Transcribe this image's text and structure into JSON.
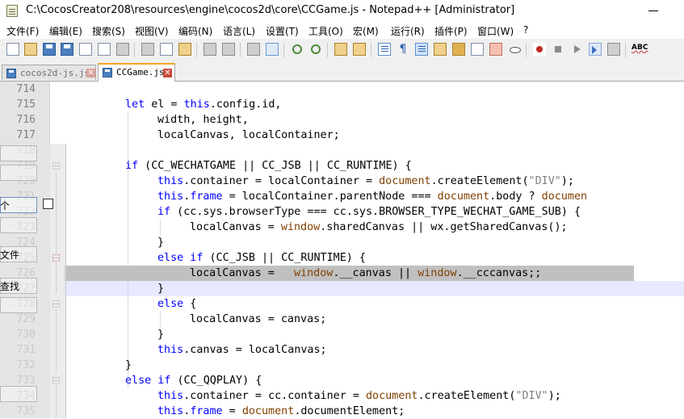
{
  "window": {
    "title": "C:\\CocosCreator208\\resources\\engine\\cocos2d\\core\\CCGame.js - Notepad++ [Administrator]",
    "minimize_glyph": "—"
  },
  "menu": [
    "文件(F)",
    "编辑(E)",
    "搜索(S)",
    "视图(V)",
    "编码(N)",
    "语言(L)",
    "设置(T)",
    "工具(O)",
    "宏(M)",
    "运行(R)",
    "插件(P)",
    "窗口(W)",
    "?"
  ],
  "toolbar": {
    "icons": [
      "new-file-icon",
      "open-file-icon",
      "save-icon",
      "save-all-icon",
      "close-icon",
      "close-all-icon",
      "print-icon",
      "cut-icon",
      "copy-icon",
      "paste-icon",
      "undo-icon",
      "redo-icon",
      "find-icon",
      "replace-icon",
      "zoom-in-icon",
      "zoom-out-icon",
      "sync-vertical-icon",
      "sync-horizontal-icon",
      "word-wrap-icon",
      "show-all-characters-icon",
      "indent-guide-icon",
      "user-language-icon",
      "document-map-icon",
      "function-list-icon",
      "folder-workspace-icon",
      "monitoring-icon",
      "record-macro-icon",
      "stop-recording-icon",
      "playback-icon",
      "run-macro-multiple-icon",
      "save-macro-icon",
      "spell-check-icon"
    ],
    "pilcrow": "¶",
    "spell_label": "ABC"
  },
  "tabs": [
    {
      "label": "cocos2d-js.js",
      "close": "✕",
      "active": false
    },
    {
      "label": "CCGame.js",
      "close": "✕",
      "active": true
    }
  ],
  "editor": {
    "line_numbers": [
      "714",
      "715",
      "716",
      "717",
      "718",
      "719",
      "720",
      "721",
      "722",
      "723",
      "724",
      "725",
      "726",
      "727",
      "728",
      "729",
      "730",
      "731",
      "732",
      "733",
      "734",
      "735"
    ],
    "lines": [
      {
        "indent": 0,
        "tokens": []
      },
      {
        "indent": 2,
        "tokens": [
          [
            "kw",
            "let"
          ],
          [
            "p",
            " el = "
          ],
          [
            "kw",
            "this"
          ],
          [
            "p",
            ".config.id,"
          ]
        ]
      },
      {
        "indent": 3,
        "tokens": [
          [
            "p",
            "width, height,"
          ]
        ]
      },
      {
        "indent": 3,
        "tokens": [
          [
            "p",
            "localCanvas, localContainer;"
          ]
        ]
      },
      {
        "indent": 0,
        "tokens": []
      },
      {
        "indent": 2,
        "tokens": [
          [
            "kw",
            "if"
          ],
          [
            "p",
            " (CC_WECHATGAME || CC_JSB || CC_RUNTIME) {"
          ]
        ]
      },
      {
        "indent": 3,
        "tokens": [
          [
            "kw",
            "this"
          ],
          [
            "p",
            ".container = localContainer = "
          ],
          [
            "obj",
            "document"
          ],
          [
            "p",
            ".createElement("
          ],
          [
            "str",
            "\"DIV\""
          ],
          [
            "p",
            ");"
          ]
        ]
      },
      {
        "indent": 3,
        "tokens": [
          [
            "kw",
            "this"
          ],
          [
            "p",
            "."
          ],
          [
            "kw",
            "frame"
          ],
          [
            "p",
            " = localContainer.parentNode === "
          ],
          [
            "obj",
            "document"
          ],
          [
            "p",
            ".body ? "
          ],
          [
            "obj",
            "documen"
          ]
        ]
      },
      {
        "indent": 3,
        "tokens": [
          [
            "kw",
            "if"
          ],
          [
            "p",
            " (cc.sys.browserType === cc.sys.BROWSER_TYPE_WECHAT_GAME_SUB) {"
          ]
        ]
      },
      {
        "indent": 4,
        "tokens": [
          [
            "p",
            "localCanvas = "
          ],
          [
            "obj",
            "window"
          ],
          [
            "p",
            ".sharedCanvas || wx.getSharedCanvas();"
          ]
        ]
      },
      {
        "indent": 3,
        "tokens": [
          [
            "p",
            "}"
          ]
        ]
      },
      {
        "indent": 3,
        "tokens": [
          [
            "kw",
            "else if"
          ],
          [
            "p",
            " (CC_JSB || CC_RUNTIME) {"
          ]
        ]
      },
      {
        "indent": 4,
        "tokens": [
          [
            "p",
            "localCanvas =   "
          ],
          [
            "obj",
            "window"
          ],
          [
            "p",
            ".__canvas || "
          ],
          [
            "obj",
            "window"
          ],
          [
            "p",
            ".__cccanvas;;"
          ]
        ]
      },
      {
        "indent": 3,
        "tokens": [
          [
            "p",
            "}"
          ]
        ]
      },
      {
        "indent": 3,
        "tokens": [
          [
            "kw",
            "else"
          ],
          [
            "p",
            " {"
          ]
        ]
      },
      {
        "indent": 4,
        "tokens": [
          [
            "p",
            "localCanvas = canvas;"
          ]
        ]
      },
      {
        "indent": 3,
        "tokens": [
          [
            "p",
            "}"
          ]
        ]
      },
      {
        "indent": 3,
        "tokens": [
          [
            "kw",
            "this"
          ],
          [
            "p",
            ".canvas = localCanvas;"
          ]
        ]
      },
      {
        "indent": 2,
        "tokens": [
          [
            "p",
            "}"
          ]
        ]
      },
      {
        "indent": 2,
        "tokens": [
          [
            "kw",
            "else if"
          ],
          [
            "p",
            " (CC_QQPLAY) {"
          ]
        ]
      },
      {
        "indent": 3,
        "tokens": [
          [
            "kw",
            "this"
          ],
          [
            "p",
            ".container = cc.container = "
          ],
          [
            "obj",
            "document"
          ],
          [
            "p",
            ".createElement("
          ],
          [
            "str",
            "\"DIV\""
          ],
          [
            "p",
            ");"
          ]
        ]
      },
      {
        "indent": 3,
        "tokens": [
          [
            "kw",
            "this"
          ],
          [
            "p",
            "."
          ],
          [
            "kw",
            "frame"
          ],
          [
            "p",
            " = "
          ],
          [
            "obj",
            "document"
          ],
          [
            "p",
            ".documentElement;"
          ]
        ]
      }
    ]
  },
  "overlay": {
    "text1": "个",
    "text2": "文件",
    "text3": "查找"
  },
  "colors": {
    "keyword": "#0000ff",
    "object": "#804000",
    "string": "#808080",
    "selection": "#c0c0c0",
    "current_line": "#e8e8ff",
    "active_tab_accent": "#f5a623"
  }
}
